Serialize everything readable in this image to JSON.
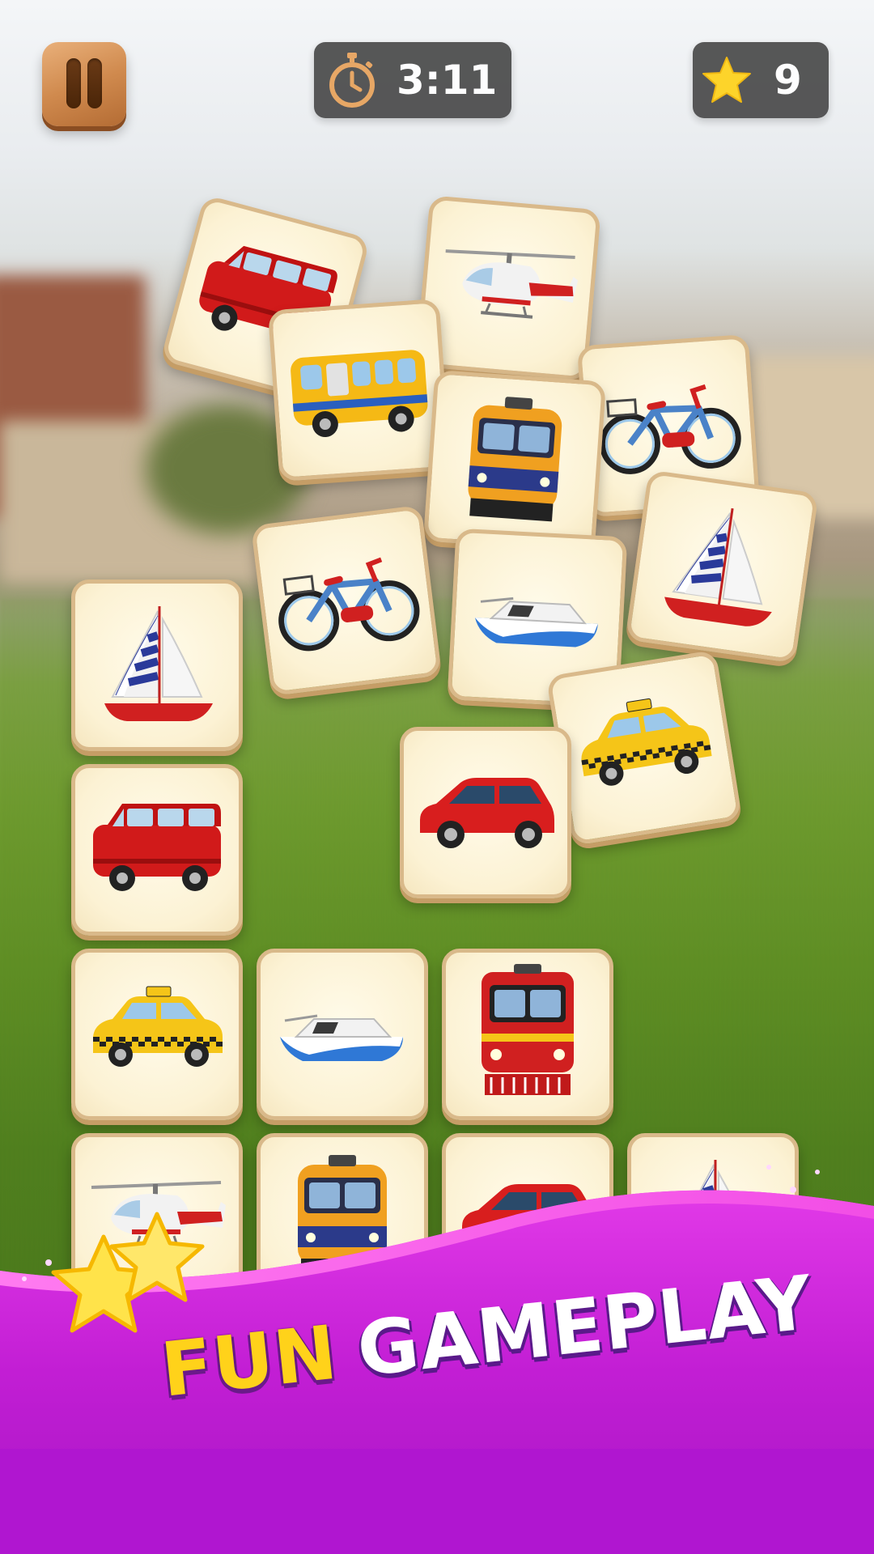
{
  "hud": {
    "pause_icon": "pause-icon",
    "timer_icon": "stopwatch-icon",
    "timer_value": "3:11",
    "score_icon": "star-icon",
    "score_value": "9"
  },
  "board": {
    "tiles": [
      {
        "vehicle": "van"
      },
      {
        "vehicle": "helicopter"
      },
      {
        "vehicle": "school-bus"
      },
      {
        "vehicle": "bicycle"
      },
      {
        "vehicle": "locomotive"
      },
      {
        "vehicle": "sailboat"
      },
      {
        "vehicle": "bicycle"
      },
      {
        "vehicle": "speedboat"
      },
      {
        "vehicle": "taxi"
      },
      {
        "vehicle": "sailboat"
      },
      {
        "vehicle": "car"
      },
      {
        "vehicle": "van"
      },
      {
        "vehicle": "taxi"
      },
      {
        "vehicle": "speedboat"
      },
      {
        "vehicle": "red-train"
      },
      {
        "vehicle": "helicopter"
      },
      {
        "vehicle": "locomotive"
      },
      {
        "vehicle": "car"
      },
      {
        "vehicle": "sailboat"
      }
    ]
  },
  "banner": {
    "word1": "FUN",
    "word2": "GAMEPLAY",
    "colors": {
      "banner": "#c41fd6",
      "word1": "#ffd21a",
      "word2": "#ffffff"
    }
  }
}
